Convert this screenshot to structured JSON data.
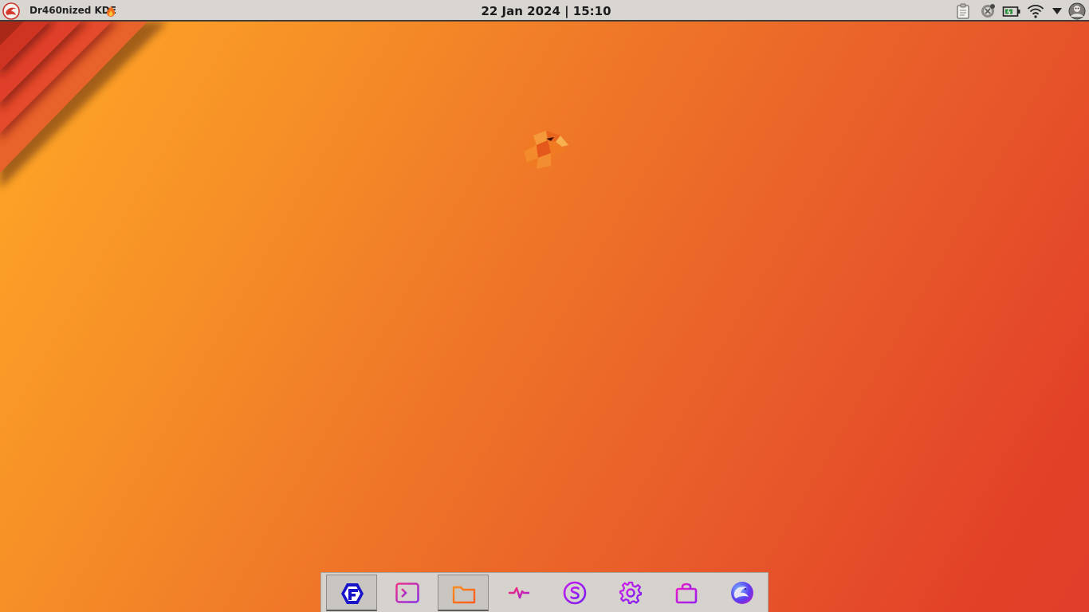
{
  "panel": {
    "title": "Dr460nized KDE",
    "clock": "22 Jan 2024 | 15:10",
    "launcher_icon": "dragon-logo-icon",
    "title_suffix_icon": "flame-icon",
    "tray": [
      "clipboard-icon",
      "updates-icon",
      "battery-icon",
      "wifi-icon",
      "tray-expand-arrow-icon",
      "user-avatar-icon"
    ]
  },
  "desktop": {
    "logo_icon": "garuda-falcon-icon",
    "colors": {
      "gradient_start": "#ffa927",
      "gradient_end": "#e0402a",
      "panel": "#d9d6d2"
    }
  },
  "dock": {
    "items": [
      {
        "icon": "garuda-welcome-icon",
        "name": "Garuda Welcome",
        "active": true
      },
      {
        "icon": "terminal-icon",
        "name": "Terminal",
        "active": false
      },
      {
        "icon": "folder-icon",
        "name": "Files",
        "active": true
      },
      {
        "icon": "system-monitor-icon",
        "name": "System Monitor",
        "active": false
      },
      {
        "icon": "snapper-icon",
        "name": "Snapshots",
        "active": false
      },
      {
        "icon": "settings-gear-icon",
        "name": "Settings",
        "active": false
      },
      {
        "icon": "store-bag-icon",
        "name": "Software Store",
        "active": false
      },
      {
        "icon": "browser-icon",
        "name": "Web Browser",
        "active": false
      }
    ]
  }
}
